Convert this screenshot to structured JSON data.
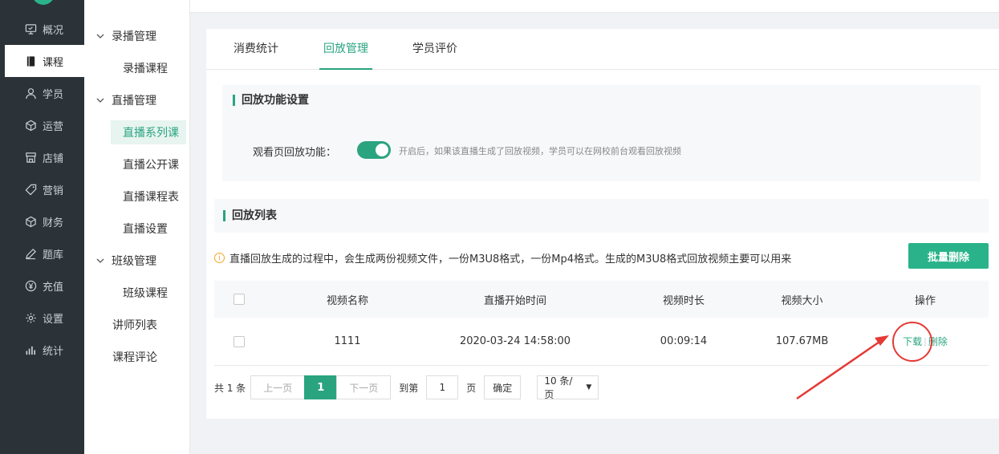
{
  "nav": {
    "items": [
      {
        "label": "概况",
        "icon": "monitor-icon"
      },
      {
        "label": "课程",
        "icon": "book-icon"
      },
      {
        "label": "学员",
        "icon": "user-icon"
      },
      {
        "label": "运营",
        "icon": "cube-icon"
      },
      {
        "label": "店铺",
        "icon": "store-icon"
      },
      {
        "label": "营销",
        "icon": "tag-icon"
      },
      {
        "label": "财务",
        "icon": "cube-icon"
      },
      {
        "label": "题库",
        "icon": "pen-icon"
      },
      {
        "label": "充值",
        "icon": "yen-icon"
      },
      {
        "label": "设置",
        "icon": "gear-icon"
      },
      {
        "label": "统计",
        "icon": "bar-chart-icon"
      }
    ]
  },
  "subnav": {
    "groups": [
      {
        "label": "录播管理",
        "items": [
          "录播课程"
        ]
      },
      {
        "label": "直播管理",
        "items": [
          "直播系列课",
          "直播公开课",
          "直播课程表",
          "直播设置"
        ]
      },
      {
        "label": "班级管理",
        "items": [
          "班级课程"
        ]
      }
    ],
    "plain": [
      "讲师列表",
      "课程评论"
    ]
  },
  "tabs": [
    "消费统计",
    "回放管理",
    "学员评价"
  ],
  "section1": {
    "title": "回放功能设置",
    "label": "观看页回放功能：",
    "hint": "开启后，如果该直播生成了回放视频，学员可以在网校前台观看回放视频",
    "enabled": true
  },
  "section2": {
    "title": "回放列表",
    "notice": "直播回放生成的过程中，会生成两份视频文件，一份M3U8格式，一份Mp4格式。生成的M3U8格式回放视频主要可以用来",
    "batch_delete": "批量删除"
  },
  "table": {
    "headers": [
      "视频名称",
      "直播开始时间",
      "视频时长",
      "视频大小",
      "操作"
    ],
    "rows": [
      {
        "name": "1111",
        "start": "2020-03-24 14:58:00",
        "duration": "00:09:14",
        "size": "107.67MB",
        "download": "下载",
        "delete": "删除"
      }
    ]
  },
  "pager": {
    "total": "共 1 条",
    "prev": "上一页",
    "current": "1",
    "next": "下一页",
    "goto": "到第",
    "page_input": "1",
    "page_unit": "页",
    "confirm": "确定",
    "page_size": "10 条/页"
  },
  "colors": {
    "accent": "#2aa47f",
    "nav_bg": "#2c3338",
    "annotation": "#e53935"
  }
}
